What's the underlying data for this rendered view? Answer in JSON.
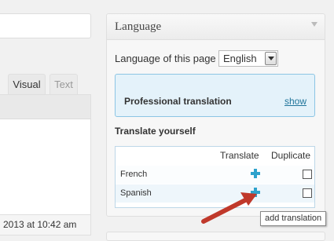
{
  "editor": {
    "tabs": [
      {
        "label": "Visual"
      },
      {
        "label": "Text"
      }
    ],
    "status": "2013 at 10:42 am"
  },
  "language_panel": {
    "title": "Language",
    "language_label": "Language of this page",
    "language_value": "English",
    "professional_label": "Professional translation",
    "show_link": "show",
    "translate_yourself": "Translate yourself",
    "columns": {
      "translate": "Translate",
      "duplicate": "Duplicate"
    },
    "rows": [
      {
        "language": "French",
        "duplicate_checked": false
      },
      {
        "language": "Spanish",
        "duplicate_checked": false
      }
    ],
    "tooltip": "add translation"
  },
  "colors": {
    "accent": "#2ea2cc",
    "annotation_arrow": "#c0392b",
    "link": "#21759b"
  },
  "icons": {
    "add": "plus-icon",
    "annotation": "arrow-annotation-icon"
  }
}
